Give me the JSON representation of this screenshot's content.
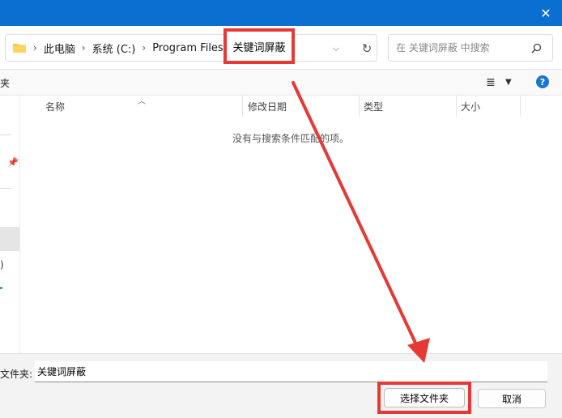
{
  "titlebar": {
    "close_glyph": "✕"
  },
  "address": {
    "crumbs": [
      "此电脑",
      "系统 (C:)",
      "Program Files"
    ],
    "current": "关键词屏蔽",
    "separator": "›"
  },
  "search": {
    "placeholder": "在 关键词屏蔽 中搜索"
  },
  "toolbar": {
    "left_label": "夹"
  },
  "columns": {
    "name": "名称",
    "modified": "修改日期",
    "type": "类型",
    "size": "大小"
  },
  "content": {
    "empty_message": "没有与搜索条件匹配的项。"
  },
  "sidebar": {
    "partial_paren": ")"
  },
  "bottom": {
    "folder_label": "文件夹:",
    "folder_value": "关键词屏蔽",
    "select_button": "选择文件夹",
    "cancel_button": "取消"
  },
  "icons": {
    "folder": "folder-icon",
    "search": "search-icon",
    "refresh": "refresh-icon",
    "dropdown": "chevron-down-icon",
    "view": "view-menu-icon",
    "help": "help-icon",
    "pin": "pin-icon"
  },
  "colors": {
    "titlebar": "#0a6fd0",
    "highlight": "#e53935",
    "help": "#1976d2",
    "folder": "#f5c244"
  }
}
